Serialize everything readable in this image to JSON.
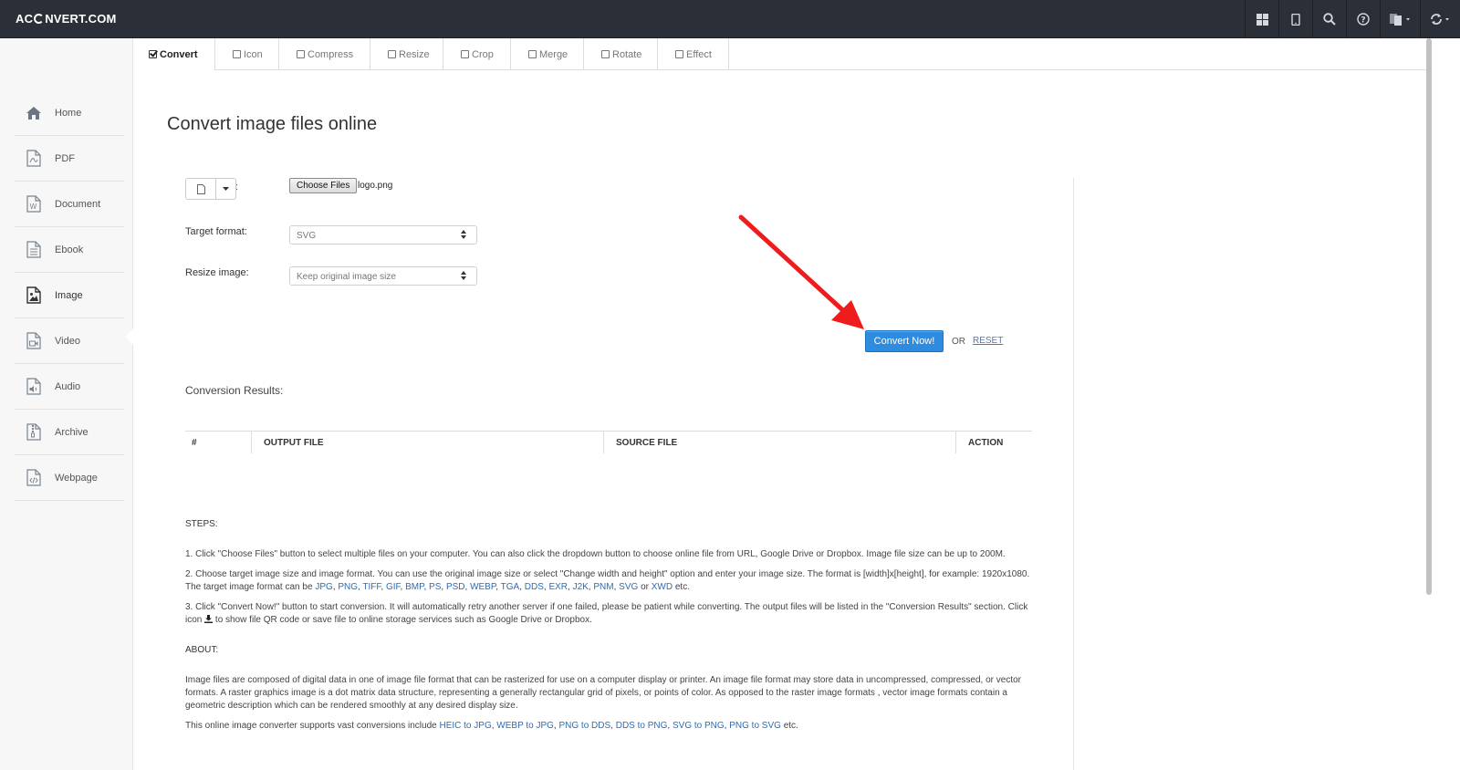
{
  "app": {
    "logo_left": "AC",
    "logo_right": "NVERT.COM"
  },
  "topbar": {
    "icons": [
      "grid-icon",
      "tablet-icon",
      "search-icon",
      "help-icon",
      "language-icon",
      "refresh-icon"
    ]
  },
  "sidebar": {
    "items": [
      {
        "label": "Home",
        "icon": "home-icon"
      },
      {
        "label": "PDF",
        "icon": "pdf-file-icon"
      },
      {
        "label": "Document",
        "icon": "word-file-icon"
      },
      {
        "label": "Ebook",
        "icon": "ebook-file-icon"
      },
      {
        "label": "Image",
        "icon": "image-file-icon",
        "active": true
      },
      {
        "label": "Video",
        "icon": "video-file-icon"
      },
      {
        "label": "Audio",
        "icon": "audio-file-icon"
      },
      {
        "label": "Archive",
        "icon": "archive-file-icon"
      },
      {
        "label": "Webpage",
        "icon": "code-file-icon"
      }
    ]
  },
  "tabs": [
    {
      "label": "Convert",
      "active": true
    },
    {
      "label": "Icon"
    },
    {
      "label": "Compress"
    },
    {
      "label": "Resize"
    },
    {
      "label": "Crop"
    },
    {
      "label": "Merge"
    },
    {
      "label": "Rotate"
    },
    {
      "label": "Effect"
    }
  ],
  "main": {
    "title": "Convert image files online",
    "file_colon": ":",
    "choose_files_label": "Choose Files",
    "file_name": "logo.png",
    "target_format_label": "Target format:",
    "target_format_value": "SVG",
    "resize_label": "Resize image:",
    "resize_value": "Keep original image size",
    "convert_button": "Convert Now!",
    "or_text": "OR",
    "reset_link": "RESET",
    "results_label": "Conversion Results:",
    "table_headers": [
      "#",
      "OUTPUT FILE",
      "SOURCE FILE",
      "ACTION"
    ]
  },
  "steps": {
    "title": "STEPS:",
    "step1": "1. Click \"Choose Files\" button to select multiple files on your computer. You can also click the dropdown button to choose online file from URL, Google Drive or Dropbox. Image file size can be up to 200M.",
    "step2_text": "2. Choose target image size and image format. You can use the original image size or select \"Change width and height\" option and enter your image size. The format is [width]x[height], for example: 1920x1080. The target image format can be",
    "step2_formats": [
      "JPG",
      "PNG",
      "TIFF",
      "GIF",
      "BMP",
      "PS",
      "PSD",
      "WEBP",
      "TGA",
      "DDS",
      "EXR",
      "J2K",
      "PNM",
      "SVG"
    ],
    "step2_or": "or",
    "step2_last": "XWD",
    "step2_end": "etc.",
    "step3_a": "3. Click \"Convert Now!\" button to start conversion. It will automatically retry another server if one failed, please be patient while converting. The output files will be listed in the \"Conversion Results\" section. Click icon",
    "step3_b": "to show file QR code or save file to online storage services such as Google Drive or Dropbox."
  },
  "about": {
    "title": "ABOUT:",
    "para1": "Image files are composed of digital data in one of image file format that can be rasterized for use on a computer display or printer. An image file format may store data in uncompressed, compressed, or vector formats. A raster graphics image is a dot matrix data structure, representing a generally rectangular grid of pixels, or points of color. As opposed to the raster image formats , vector image formats contain a geometric description which can be rendered smoothly at any desired display size.",
    "para2_text": "This online image converter supports vast conversions include",
    "para2_links": [
      "HEIC to JPG",
      "WEBP to JPG",
      "PNG to DDS",
      "DDS to PNG",
      "SVG to PNG",
      "PNG to SVG"
    ],
    "para2_end": "etc."
  }
}
